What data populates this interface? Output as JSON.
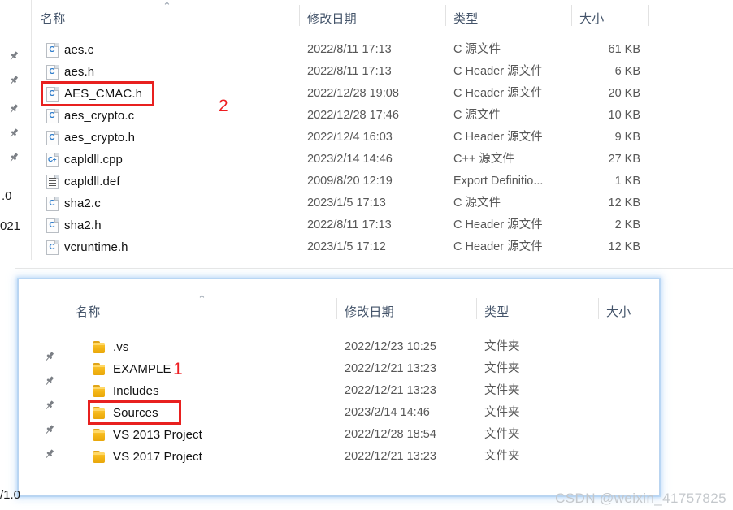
{
  "colors": {
    "annotation_red": "#ee1c20",
    "header_text": "#44546a",
    "folder_yellow": "#f3b414",
    "c_glyph_blue": "#2878c8",
    "window_glow": "#b9d4f0",
    "watermark": "#c4c8cc"
  },
  "top_pane": {
    "sort_indicator": "⌃",
    "columns": {
      "name": "名称",
      "date": "修改日期",
      "type": "类型",
      "size": "大小"
    },
    "rows": [
      {
        "icon": "c-source-file-icon",
        "glyph": "C",
        "name": "aes.c",
        "date": "2022/8/11 17:13",
        "type": "C 源文件",
        "size": "61 KB"
      },
      {
        "icon": "c-header-file-icon",
        "glyph": "C",
        "name": "aes.h",
        "date": "2022/8/11 17:13",
        "type": "C Header 源文件",
        "size": "6 KB"
      },
      {
        "icon": "c-header-file-icon",
        "glyph": "C",
        "name": "AES_CMAC.h",
        "date": "2022/12/28 19:08",
        "type": "C Header 源文件",
        "size": "20 KB"
      },
      {
        "icon": "c-source-file-icon",
        "glyph": "C",
        "name": "aes_crypto.c",
        "date": "2022/12/28 17:46",
        "type": "C 源文件",
        "size": "10 KB"
      },
      {
        "icon": "c-header-file-icon",
        "glyph": "C",
        "name": "aes_crypto.h",
        "date": "2022/12/4 16:03",
        "type": "C Header 源文件",
        "size": "9 KB"
      },
      {
        "icon": "cpp-source-file-icon",
        "glyph": "C+",
        "name": "capldll.cpp",
        "date": "2023/2/14 14:46",
        "type": "C++ 源文件",
        "size": "27 KB"
      },
      {
        "icon": "def-file-icon",
        "glyph": "",
        "name": "capldll.def",
        "date": "2009/8/20 12:19",
        "type": "Export Definitio...",
        "size": "1 KB"
      },
      {
        "icon": "c-source-file-icon",
        "glyph": "C",
        "name": "sha2.c",
        "date": "2023/1/5 17:13",
        "type": "C 源文件",
        "size": "12 KB"
      },
      {
        "icon": "c-header-file-icon",
        "glyph": "C",
        "name": "sha2.h",
        "date": "2022/8/11 17:13",
        "type": "C Header 源文件",
        "size": "2 KB"
      },
      {
        "icon": "c-header-file-icon",
        "glyph": "C",
        "name": "vcruntime.h",
        "date": "2023/1/5 17:12",
        "type": "C Header 源文件",
        "size": "12 KB"
      }
    ],
    "pin_count": 5,
    "pin_glyph": "📌",
    "annotation": {
      "label": "2",
      "target_row": "AES_CMAC.h"
    }
  },
  "bottom_pane": {
    "address_bar_clipped_text": "· · · · ·",
    "sort_indicator": "⌃",
    "columns": {
      "name": "名称",
      "date": "修改日期",
      "type": "类型",
      "size": "大小"
    },
    "rows": [
      {
        "icon": "folder-icon",
        "name": ".vs",
        "date": "2022/12/23 10:25",
        "type": "文件夹",
        "size": ""
      },
      {
        "icon": "folder-icon",
        "name": "EXAMPLE",
        "date": "2022/12/21 13:23",
        "type": "文件夹",
        "size": ""
      },
      {
        "icon": "folder-icon",
        "name": "Includes",
        "date": "2022/12/21 13:23",
        "type": "文件夹",
        "size": ""
      },
      {
        "icon": "folder-icon",
        "name": "Sources",
        "date": "2023/2/14 14:46",
        "type": "文件夹",
        "size": ""
      },
      {
        "icon": "folder-icon",
        "name": "VS 2013 Project",
        "date": "2022/12/28 18:54",
        "type": "文件夹",
        "size": ""
      },
      {
        "icon": "folder-icon",
        "name": "VS 2017 Project",
        "date": "2022/12/21 13:23",
        "type": "文件夹",
        "size": ""
      }
    ],
    "pin_count": 5,
    "pin_glyph": "📌",
    "annotation": {
      "label": "1",
      "target_row": "Sources"
    }
  },
  "margin_fragments": {
    "frag_1": ".0",
    "frag_2": "021",
    "frag_3": "/1.0"
  },
  "watermark": "CSDN @weixin_41757825"
}
